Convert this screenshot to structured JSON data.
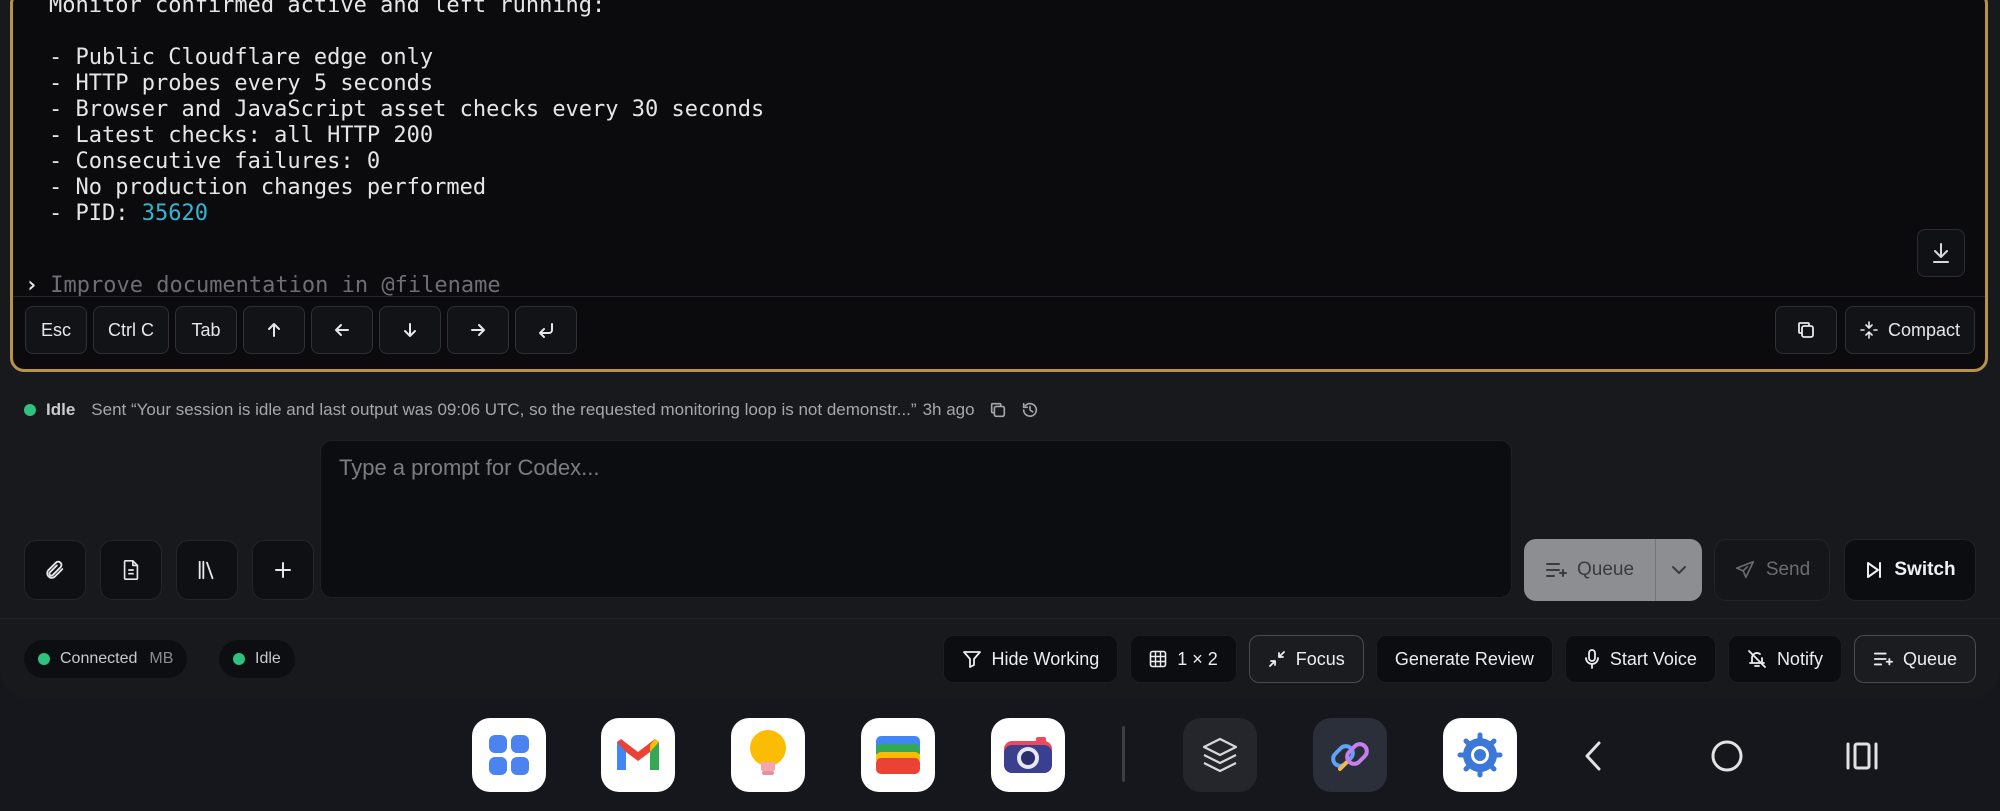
{
  "terminal": {
    "lines": [
      "Monitor confirmed active and left running:",
      "",
      "- Public Cloudflare edge only",
      "- HTTP probes every 5 seconds",
      "- Browser and JavaScript asset checks every 30 seconds",
      "- Latest checks: all HTTP 200",
      "- Consecutive failures: 0",
      "- No production changes performed"
    ],
    "pid_label": "- PID: ",
    "pid_value": "35620",
    "prompt_caret": "›",
    "prompt_placeholder": "Improve documentation in @filename",
    "keys": [
      "Esc",
      "Ctrl C",
      "Tab",
      "↑",
      "←",
      "↓",
      "→",
      "↵"
    ],
    "compact_label": "Compact"
  },
  "status": {
    "state": "Idle",
    "message": "Sent “Your session is idle and last output was 09:06 UTC, so the requested monitoring loop is not demonstr...”",
    "time": "3h ago"
  },
  "composer": {
    "placeholder": "Type a prompt for Codex...",
    "queue_label": "Queue",
    "send_label": "Send",
    "switch_label": "Switch"
  },
  "footer": {
    "connected_label": "Connected",
    "connected_host": "MB",
    "idle_label": "Idle",
    "buttons": {
      "hide_working": "Hide Working",
      "layout": "1 × 2",
      "focus": "Focus",
      "generate_review": "Generate Review",
      "start_voice": "Start Voice",
      "notify": "Notify",
      "queue": "Queue"
    }
  },
  "colors": {
    "accent_border": "#b8924a",
    "status_green": "#2ec27e",
    "pid_cyan": "#34b6d4"
  },
  "dock": {
    "apps": [
      "apps-grid-icon",
      "gmail-icon",
      "keep-icon",
      "wallet-icon",
      "camera-icon",
      "layers-icon",
      "link-icon",
      "settings-icon"
    ],
    "nav": [
      "back-icon",
      "home-icon",
      "recents-icon"
    ]
  }
}
